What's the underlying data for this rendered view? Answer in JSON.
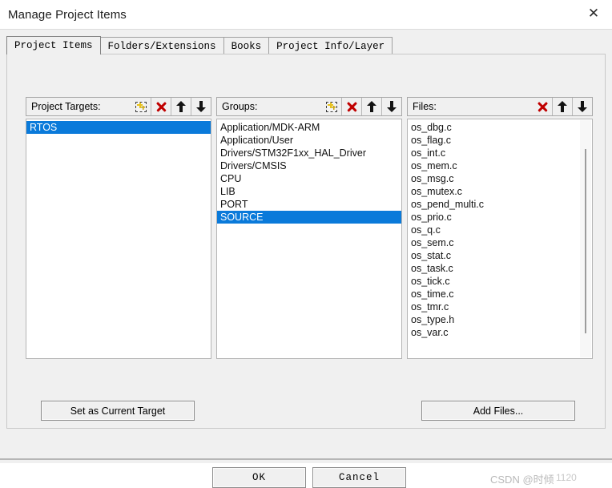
{
  "window": {
    "title": "Manage Project Items",
    "close_icon": "close-icon"
  },
  "tabs": [
    {
      "label": "Project Items",
      "active": true
    },
    {
      "label": "Folders/Extensions",
      "active": false
    },
    {
      "label": "Books",
      "active": false
    },
    {
      "label": "Project Info/Layer",
      "active": false
    }
  ],
  "panels": {
    "targets": {
      "label": "Project Targets:",
      "tools": [
        "new-item-icon",
        "delete-icon",
        "move-up-icon",
        "move-down-icon"
      ],
      "items": [
        "RTOS"
      ],
      "selected": "RTOS"
    },
    "groups": {
      "label": "Groups:",
      "tools": [
        "new-item-icon",
        "delete-icon",
        "move-up-icon",
        "move-down-icon"
      ],
      "items": [
        "Application/MDK-ARM",
        "Application/User",
        "Drivers/STM32F1xx_HAL_Driver",
        "Drivers/CMSIS",
        "CPU",
        "LIB",
        "PORT",
        "SOURCE"
      ],
      "selected": "SOURCE"
    },
    "files": {
      "label": "Files:",
      "tools": [
        "delete-icon",
        "move-up-icon",
        "move-down-icon"
      ],
      "items": [
        "os_dbg.c",
        "os_flag.c",
        "os_int.c",
        "os_mem.c",
        "os_msg.c",
        "os_mutex.c",
        "os_pend_multi.c",
        "os_prio.c",
        "os_q.c",
        "os_sem.c",
        "os_stat.c",
        "os_task.c",
        "os_tick.c",
        "os_time.c",
        "os_tmr.c",
        "os_type.h",
        "os_var.c"
      ],
      "selected": null,
      "has_scrollbar": true
    }
  },
  "buttons": {
    "set_current_target": "Set as Current Target",
    "add_files": "Add Files...",
    "ok": "OK",
    "cancel": "Cancel"
  },
  "watermark": {
    "text": "CSDN @时倾",
    "overlay": "1120"
  },
  "colors": {
    "selection": "#0a7ada",
    "dialog_bg": "#f0f0f0",
    "delete_icon": "#c00000",
    "list_bg": "#ffffff"
  }
}
